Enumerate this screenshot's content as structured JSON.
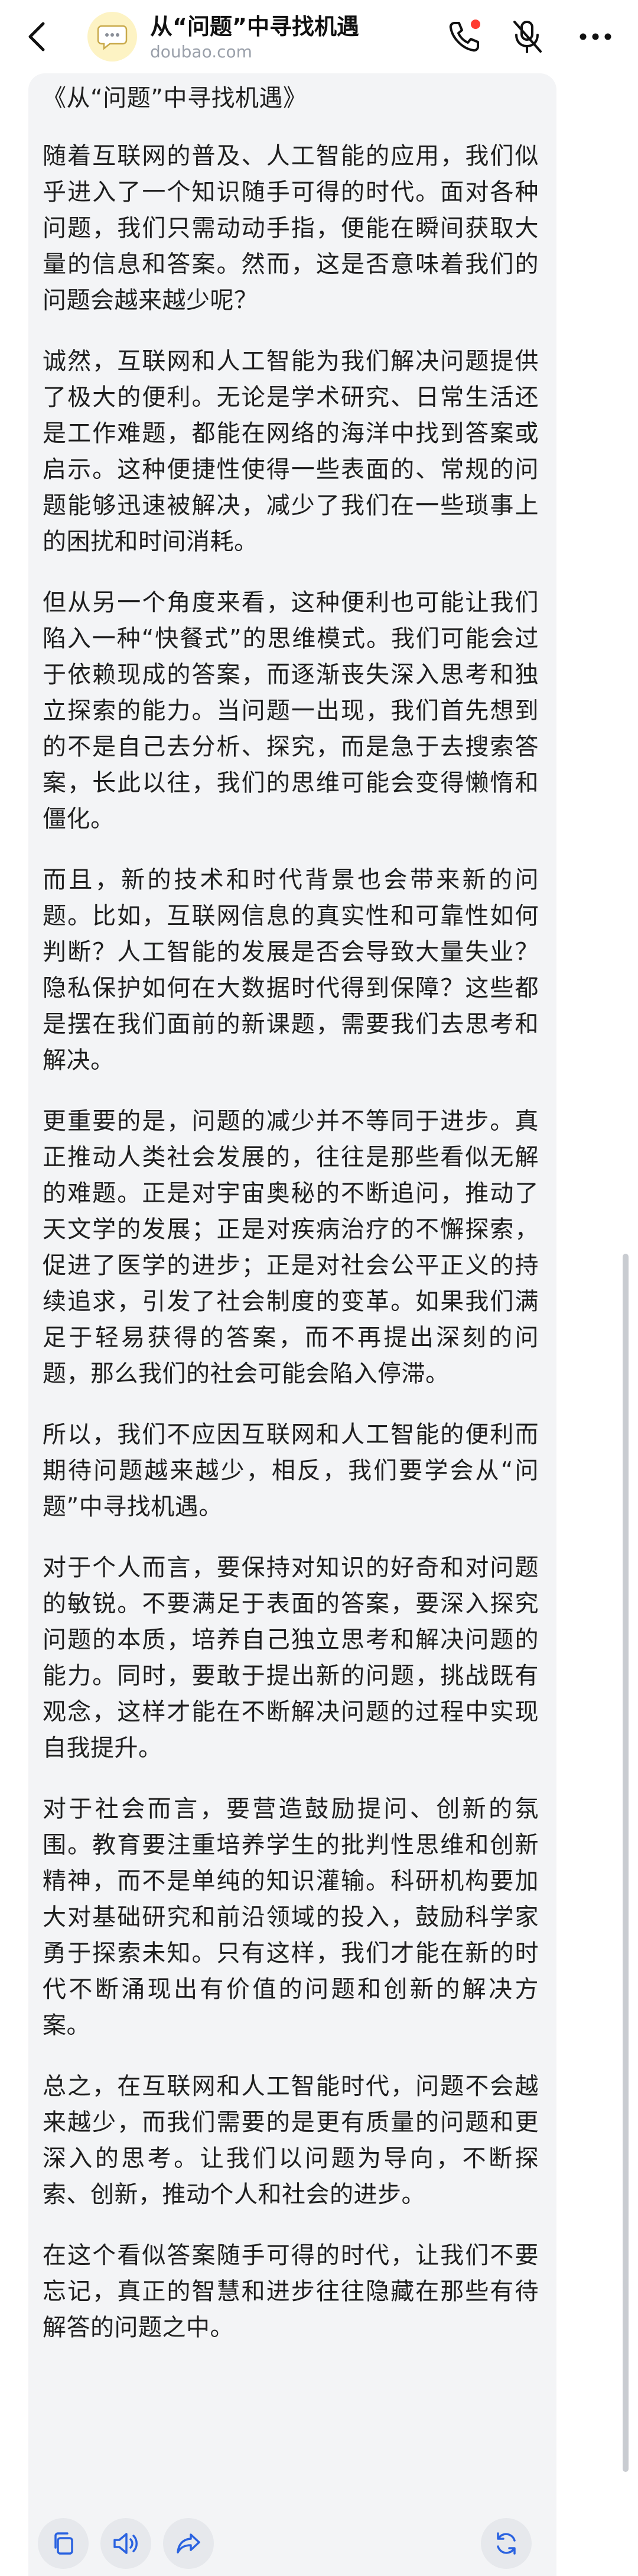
{
  "header": {
    "title": "从“问题”中寻找机遇",
    "subtitle": "doubao.com",
    "icons": {
      "back": "chevron-left-icon",
      "avatar": "chat-bubble-icon",
      "call": "phone-icon",
      "mute": "mic-off-icon",
      "more": "more-horizontal-icon"
    },
    "notification_color": "#ff3b30"
  },
  "message": {
    "title": "《从“问题”中寻找机遇》",
    "paragraphs": [
      "随着互联网的普及、人工智能的应用，我们似乎进入了一个知识随手可得的时代。面对各种问题，我们只需动动手指，便能在瞬间获取大量的信息和答案。然而，这是否意味着我们的问题会越来越少呢？",
      "诚然，互联网和人工智能为我们解决问题提供了极大的便利。无论是学术研究、日常生活还是工作难题，都能在网络的海洋中找到答案或启示。这种便捷性使得一些表面的、常规的问题能够迅速被解决，减少了我们在一些琐事上的困扰和时间消耗。",
      "但从另一个角度来看，这种便利也可能让我们陷入一种“快餐式”的思维模式。我们可能会过于依赖现成的答案，而逐渐丧失深入思考和独立探索的能力。当问题一出现，我们首先想到的不是自己去分析、探究，而是急于去搜索答案，长此以往，我们的思维可能会变得懒惰和僵化。",
      "而且，新的技术和时代背景也会带来新的问题。比如，互联网信息的真实性和可靠性如何判断？人工智能的发展是否会导致大量失业？隐私保护如何在大数据时代得到保障？这些都是摆在我们面前的新课题，需要我们去思考和解决。",
      "更重要的是，问题的减少并不等同于进步。真正推动人类社会发展的，往往是那些看似无解的难题。正是对宇宙奥秘的不断追问，推动了天文学的发展；正是对疾病治疗的不懈探索，促进了医学的进步；正是对社会公平正义的持续追求，引发了社会制度的变革。如果我们满足于轻易获得的答案，而不再提出深刻的问题，那么我们的社会可能会陷入停滞。",
      "所以，我们不应因互联网和人工智能的便利而期待问题越来越少，相反，我们要学会从“问题”中寻找机遇。",
      "对于个人而言，要保持对知识的好奇和对问题的敏锐。不要满足于表面的答案，要深入探究问题的本质，培养自己独立思考和解决问题的能力。同时，要敢于提出新的问题，挑战既有观念，这样才能在不断解决问题的过程中实现自我提升。",
      "对于社会而言，要营造鼓励提问、创新的氛围。教育要注重培养学生的批判性思维和创新精神，而不是单纯的知识灌输。科研机构要加大对基础研究和前沿领域的投入，鼓励科学家勇于探索未知。只有这样，我们才能在新的时代不断涌现出有价值的问题和创新的解决方案。",
      "总之，在互联网和人工智能时代，问题不会越来越少，而我们需要的是更有质量的问题和更深入的思考。让我们以问题为导向，不断探索、创新，推动个人和社会的进步。",
      "在这个看似答案随手可得的时代，让我们不要忘记，真正的智慧和进步往往隐藏在那些有待解答的问题之中。"
    ]
  },
  "toolbar": {
    "icons": [
      "copy-icon",
      "speaker-icon",
      "share-icon",
      "regenerate-icon"
    ],
    "accent": "#2a62e0"
  }
}
